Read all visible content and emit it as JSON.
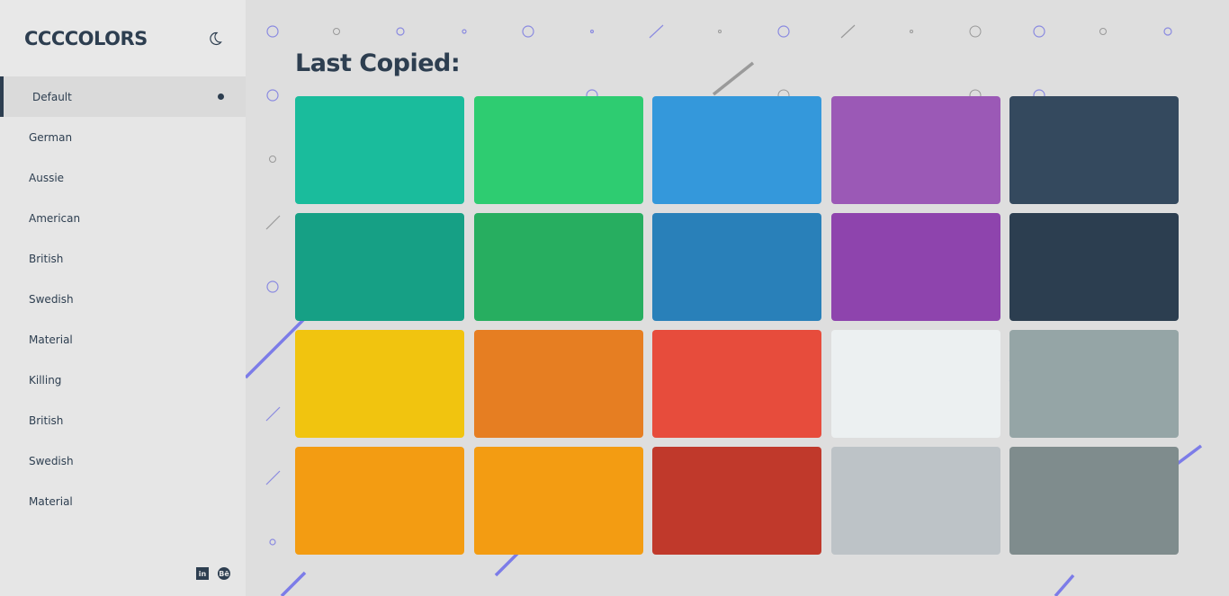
{
  "brand": {
    "logo": "CCCCOLORS",
    "theme_toggle_icon": "moon-icon"
  },
  "sidebar": {
    "items": [
      {
        "label": "Default",
        "active": true
      },
      {
        "label": "German"
      },
      {
        "label": "Aussie"
      },
      {
        "label": "American"
      },
      {
        "label": "British"
      },
      {
        "label": "Swedish"
      },
      {
        "label": "Material"
      },
      {
        "label": "Killing"
      },
      {
        "label": "British"
      },
      {
        "label": "Swedish"
      },
      {
        "label": "Material"
      }
    ],
    "socials": [
      {
        "icon": "linkedin-icon",
        "text": "in"
      },
      {
        "icon": "behance-icon",
        "text": "Bē"
      }
    ]
  },
  "main": {
    "title": "Last Copied:",
    "swatches": [
      "#1abc9c",
      "#2ecc71",
      "#3498db",
      "#9b59b6",
      "#34495e",
      "#16a085",
      "#27ae60",
      "#2980b9",
      "#8e44ad",
      "#2c3e50",
      "#f1c40f",
      "#e67e22",
      "#e74c3c",
      "#ecf0f1",
      "#95a5a6",
      "#f39c12",
      "#f39c12",
      "#c0392b",
      "#bdc3c7",
      "#7f8c8d"
    ]
  },
  "colors": {
    "text_dark": "#2d3e50",
    "accent_decoration": "#7c7ce8",
    "sidebar_bg": "#e6e6e6",
    "page_bg": "#dedede"
  }
}
